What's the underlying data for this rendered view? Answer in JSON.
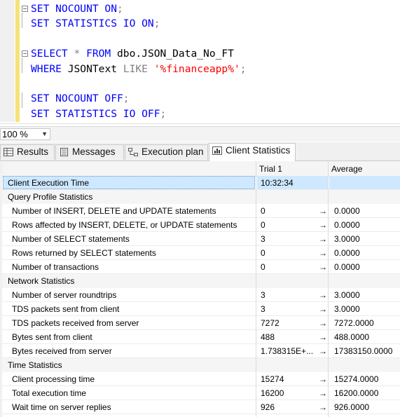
{
  "editor": {
    "lines": [
      {
        "parts": [
          {
            "t": "SET NOCOUNT ON",
            "c": "kw"
          },
          {
            "t": ";",
            "c": "gr"
          }
        ]
      },
      {
        "parts": [
          {
            "t": "SET STATISTICS IO ON",
            "c": "kw"
          },
          {
            "t": ";",
            "c": "gr"
          }
        ]
      },
      {
        "parts": []
      },
      {
        "parts": [
          {
            "t": "SELECT",
            "c": "kw"
          },
          {
            "t": " * ",
            "c": "gr"
          },
          {
            "t": "FROM",
            "c": "kw"
          },
          {
            "t": " dbo.JSON_Data_No_FT",
            "c": "tx"
          }
        ]
      },
      {
        "parts": [
          {
            "t": "WHERE",
            "c": "kw"
          },
          {
            "t": " JSONText ",
            "c": "tx"
          },
          {
            "t": "LIKE",
            "c": "gr"
          },
          {
            "t": " ",
            "c": "tx"
          },
          {
            "t": "'%financeapp%'",
            "c": "st"
          },
          {
            "t": ";",
            "c": "gr"
          }
        ]
      },
      {
        "parts": []
      },
      {
        "parts": [
          {
            "t": "SET NOCOUNT OFF",
            "c": "kw"
          },
          {
            "t": ";",
            "c": "gr"
          }
        ]
      },
      {
        "parts": [
          {
            "t": "SET STATISTICS IO OFF",
            "c": "kw"
          },
          {
            "t": ";",
            "c": "gr"
          }
        ]
      }
    ]
  },
  "zoom": {
    "value": "100 %"
  },
  "tabs": {
    "results": "Results",
    "messages": "Messages",
    "execution_plan": "Execution plan",
    "client_statistics": "Client Statistics"
  },
  "grid": {
    "headers": {
      "trial": "Trial  1",
      "average": "Average"
    },
    "rows": [
      {
        "type": "selected",
        "name": "Client Execution Time",
        "v1": "10:32:34",
        "arrow": "",
        "v2": ""
      },
      {
        "type": "section",
        "name": "Query Profile Statistics",
        "v1": "",
        "arrow": "",
        "v2": ""
      },
      {
        "type": "data",
        "name": "Number of INSERT, DELETE and UPDATE statements",
        "v1": "0",
        "arrow": "→",
        "v2": "0.0000"
      },
      {
        "type": "data",
        "name": "Rows affected by INSERT, DELETE, or UPDATE statements",
        "v1": "0",
        "arrow": "→",
        "v2": "0.0000"
      },
      {
        "type": "data",
        "name": "Number of SELECT statements",
        "v1": "3",
        "arrow": "→",
        "v2": "3.0000"
      },
      {
        "type": "data",
        "name": "Rows returned by SELECT statements",
        "v1": "0",
        "arrow": "→",
        "v2": "0.0000"
      },
      {
        "type": "data",
        "name": "Number of transactions",
        "v1": "0",
        "arrow": "→",
        "v2": "0.0000"
      },
      {
        "type": "section",
        "name": "Network Statistics",
        "v1": "",
        "arrow": "",
        "v2": ""
      },
      {
        "type": "data",
        "name": "Number of server roundtrips",
        "v1": "3",
        "arrow": "→",
        "v2": "3.0000"
      },
      {
        "type": "data",
        "name": "TDS packets sent from client",
        "v1": "3",
        "arrow": "→",
        "v2": "3.0000"
      },
      {
        "type": "data",
        "name": "TDS packets received from server",
        "v1": "7272",
        "arrow": "→",
        "v2": "7272.0000"
      },
      {
        "type": "data",
        "name": "Bytes sent from client",
        "v1": "488",
        "arrow": "→",
        "v2": "488.0000"
      },
      {
        "type": "data",
        "name": "Bytes received from server",
        "v1": "1.738315E+...",
        "arrow": "→",
        "v2": "17383150.0000"
      },
      {
        "type": "section",
        "name": "Time Statistics",
        "v1": "",
        "arrow": "",
        "v2": ""
      },
      {
        "type": "data",
        "name": "Client processing time",
        "v1": "15274",
        "arrow": "→",
        "v2": "15274.0000"
      },
      {
        "type": "data",
        "name": "Total execution time",
        "v1": "16200",
        "arrow": "→",
        "v2": "16200.0000"
      },
      {
        "type": "data",
        "name": "Wait time on server replies",
        "v1": "926",
        "arrow": "→",
        "v2": "926.0000"
      }
    ]
  },
  "colors": {
    "keyword": "#0000ff",
    "string": "#ff0000",
    "operator": "#808080",
    "selection": "#cde8ff",
    "margin_marker": "#f6e27a"
  }
}
